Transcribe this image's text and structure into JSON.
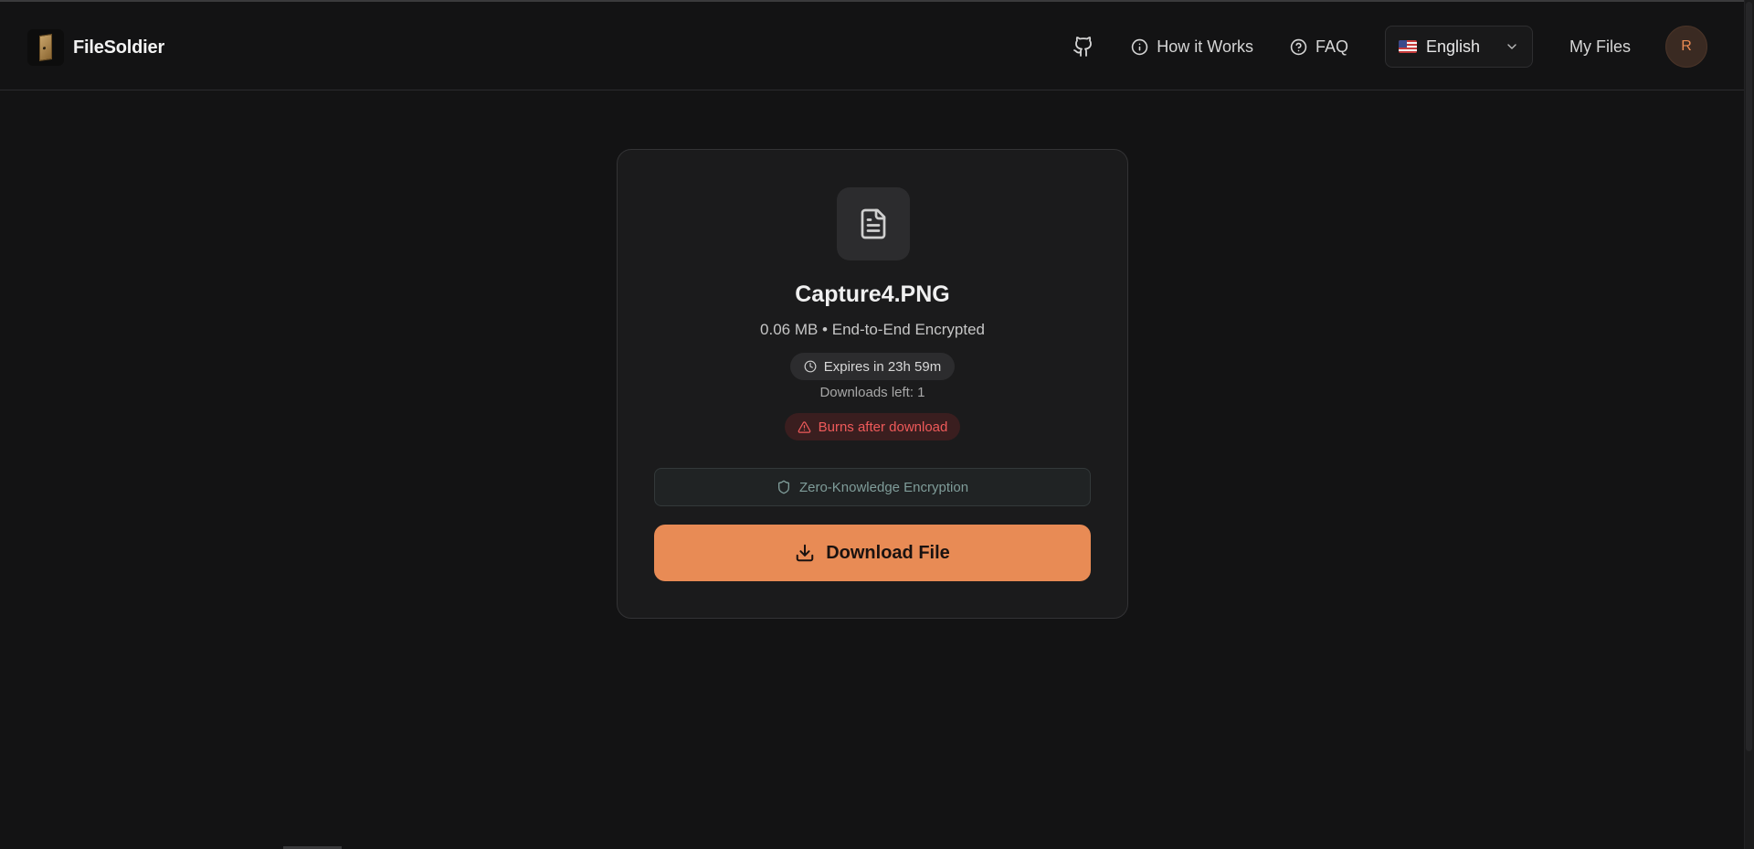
{
  "header": {
    "brand_name": "FileSoldier",
    "nav": {
      "how_it_works": "How it Works",
      "faq": "FAQ",
      "language": "English",
      "my_files": "My Files",
      "avatar_initial": "R"
    }
  },
  "file": {
    "name": "Capture4.PNG",
    "meta": "0.06 MB • End-to-End Encrypted",
    "expires": "Expires in 23h 59m",
    "downloads_left": "Downloads left: 1",
    "burn_notice": "Burns after download",
    "encryption_badge": "Zero-Knowledge Encryption",
    "download_label": "Download File"
  },
  "icons": {
    "logo": "door-logo",
    "github": "github-icon",
    "info": "info-icon",
    "help": "help-circle-icon",
    "flag": "us-flag-icon",
    "chevron": "chevron-down-icon",
    "file": "file-text-icon",
    "clock": "clock-icon",
    "warning": "alert-triangle-icon",
    "shield": "shield-icon",
    "download": "download-icon"
  },
  "colors": {
    "background": "#131314",
    "card": "#1b1b1c",
    "accent": "#e88b55",
    "danger": "#ef5a5a",
    "encryption": "#7f9c99"
  }
}
